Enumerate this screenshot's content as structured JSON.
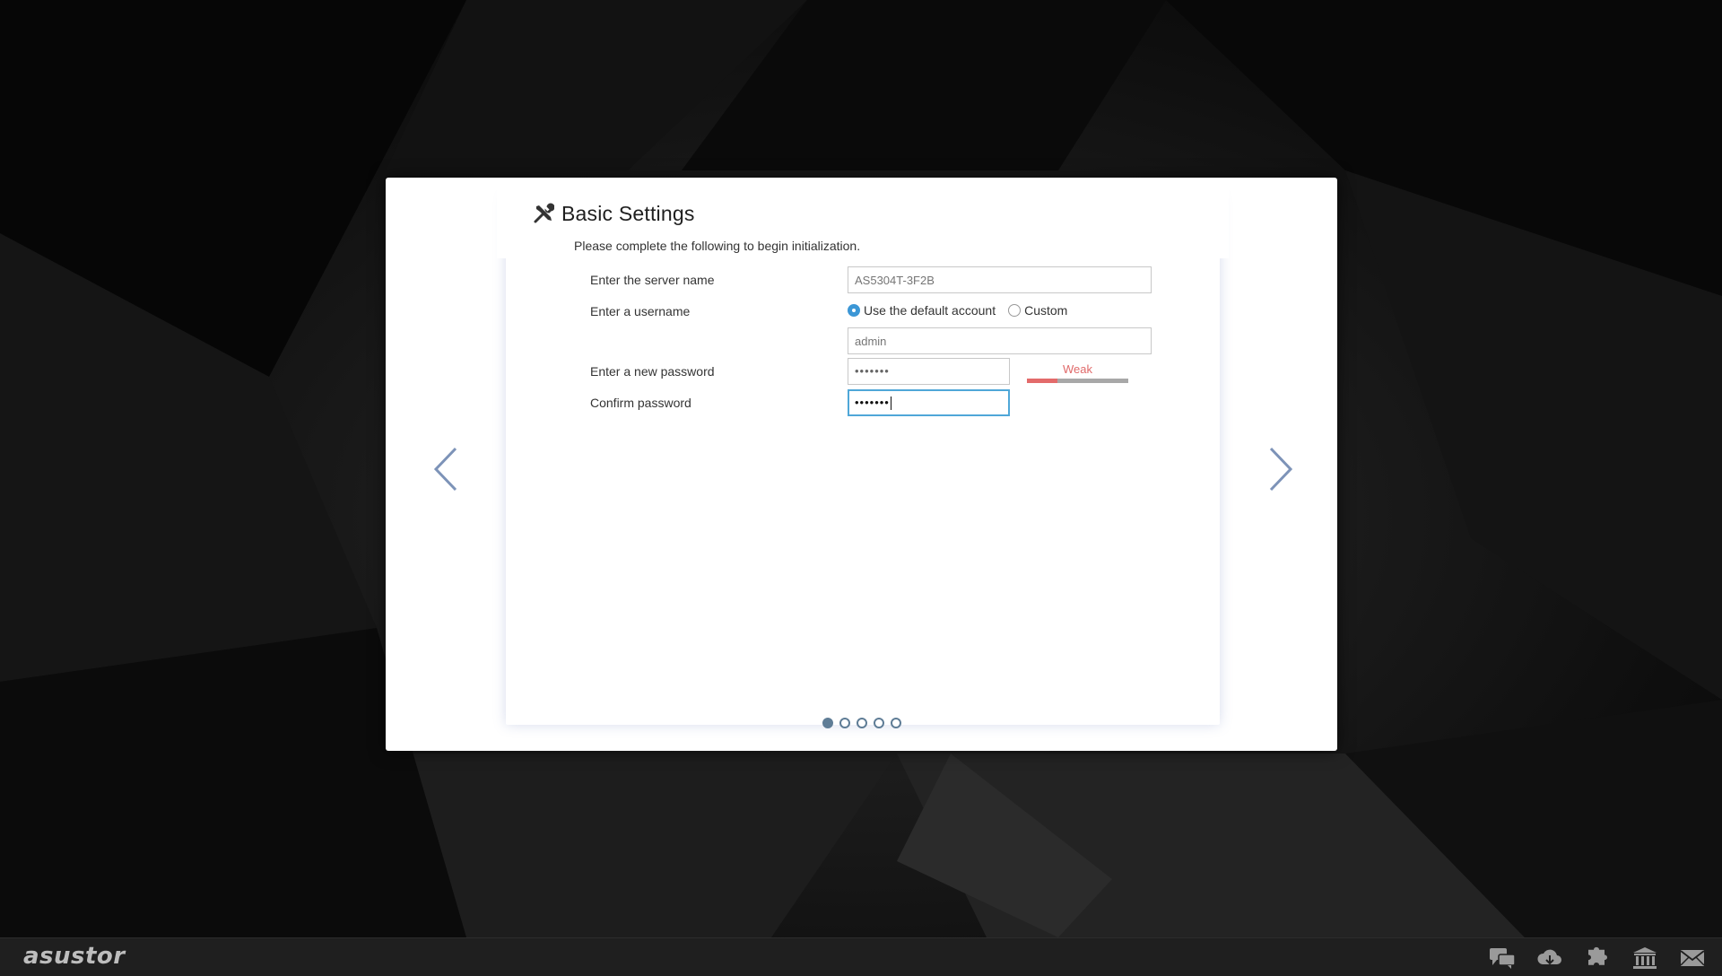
{
  "dialog": {
    "title": "Basic Settings",
    "title_icon": "tools-icon",
    "subtitle": "Please complete the following to begin initialization."
  },
  "form": {
    "server_name": {
      "label": "Enter the server name",
      "placeholder": "AS5304T-3F2B"
    },
    "username": {
      "label": "Enter a username",
      "options": [
        {
          "label": "Use the default account",
          "checked": true
        },
        {
          "label": "Custom",
          "checked": false
        }
      ],
      "placeholder": "admin"
    },
    "new_password": {
      "label": "Enter a new password",
      "value": "•••••••",
      "strength_label": "Weak",
      "strength_fraction": 0.3
    },
    "confirm_password": {
      "label": "Confirm password",
      "value": "•••••••"
    }
  },
  "navigation": {
    "prev_icon": "chevron-left-icon",
    "next_icon": "chevron-right-icon",
    "steps_total": 5,
    "current_step": 1
  },
  "taskbar": {
    "logo": "asustor",
    "icons": [
      "chat-icon",
      "cloud-download-icon",
      "puzzle-icon",
      "bank-icon",
      "mail-icon"
    ]
  },
  "colors": {
    "accent": "#3c97d6",
    "focus_border": "#4fa7d8",
    "weak": "#e36b6b",
    "step_dot": "#5f7d96",
    "arrow": "#7d93b8"
  }
}
